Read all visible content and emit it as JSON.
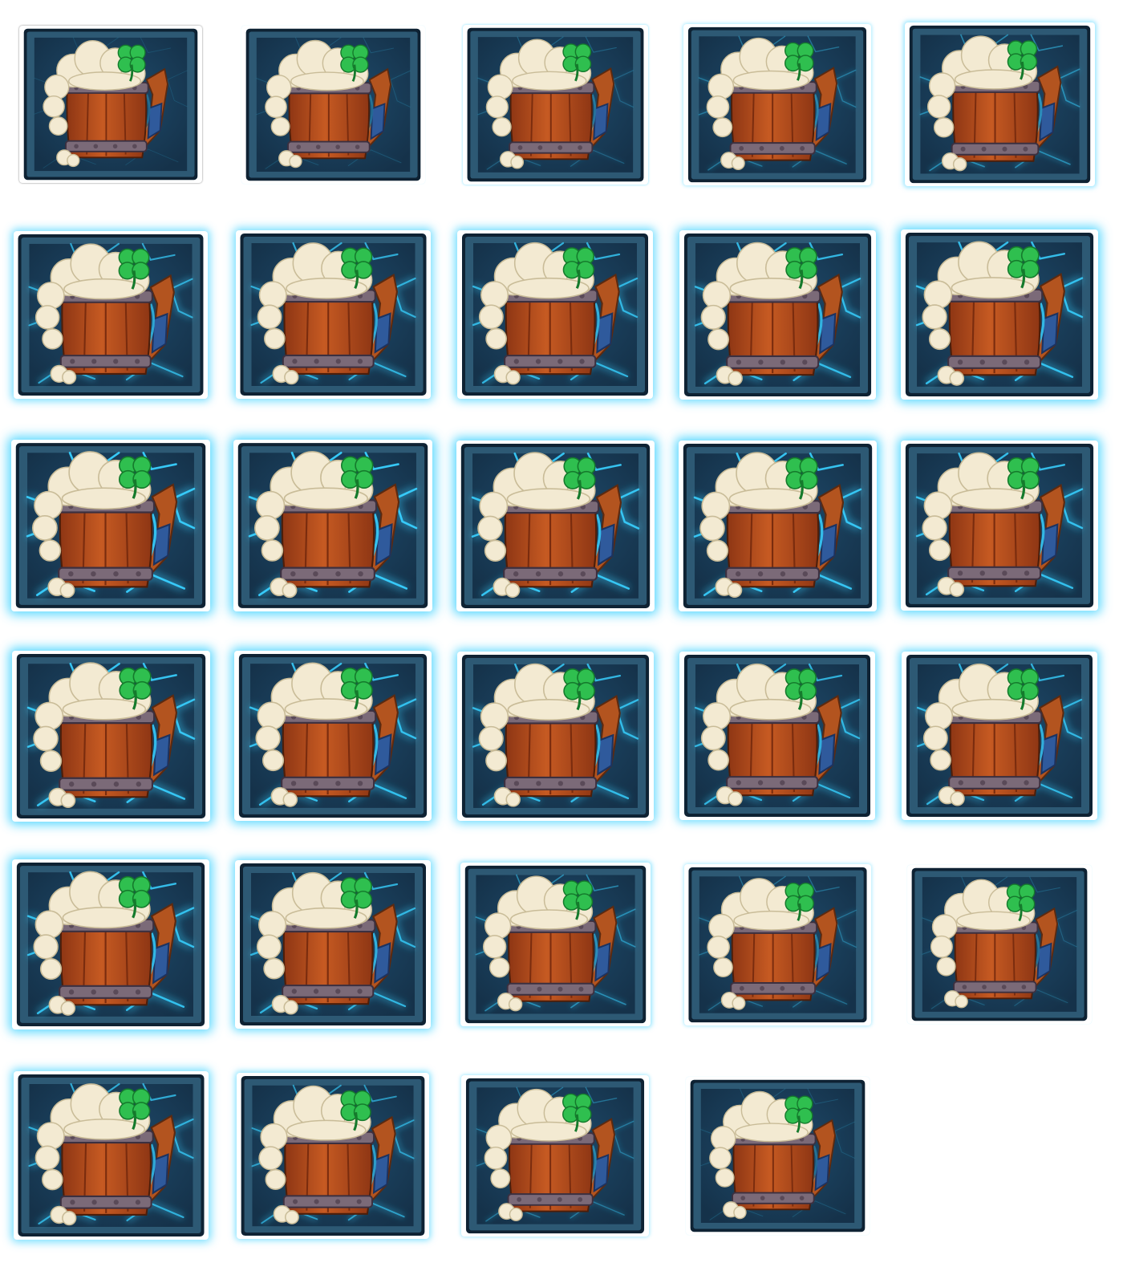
{
  "sheet": {
    "title": "",
    "symbol_name": "beer-mug-clover-symbol",
    "frame_count": 29,
    "columns": 5,
    "colors": {
      "background": "#ffffff",
      "tile_dark": "#15324a",
      "tile_mid": "#1f4d6e",
      "bevel": "#2d5974",
      "glow": "#38d0ff",
      "wood": "#c65a22",
      "wood_dark": "#8e3614",
      "metal": "#7b6a78",
      "foam": "#f3ead2",
      "clover": "#2fbf4f",
      "handle": "#b3541f",
      "grip": "#2f5a9c"
    }
  },
  "frames": [
    {
      "id": 1,
      "glow": 0.0
    },
    {
      "id": 2,
      "glow": 0.05
    },
    {
      "id": 3,
      "glow": 0.15
    },
    {
      "id": 4,
      "glow": 0.3
    },
    {
      "id": 5,
      "glow": 0.45
    },
    {
      "id": 6,
      "glow": 0.7
    },
    {
      "id": 7,
      "glow": 0.75
    },
    {
      "id": 8,
      "glow": 0.8
    },
    {
      "id": 9,
      "glow": 0.85
    },
    {
      "id": 10,
      "glow": 0.9
    },
    {
      "id": 11,
      "glow": 1.0
    },
    {
      "id": 12,
      "glow": 1.0
    },
    {
      "id": 13,
      "glow": 0.95
    },
    {
      "id": 14,
      "glow": 0.95
    },
    {
      "id": 15,
      "glow": 0.9
    },
    {
      "id": 16,
      "glow": 0.95
    },
    {
      "id": 17,
      "glow": 0.9
    },
    {
      "id": 18,
      "glow": 0.85
    },
    {
      "id": 19,
      "glow": 0.8
    },
    {
      "id": 20,
      "glow": 0.8
    },
    {
      "id": 21,
      "glow": 0.9
    },
    {
      "id": 22,
      "glow": 0.8
    },
    {
      "id": 23,
      "glow": 0.45
    },
    {
      "id": 24,
      "glow": 0.25
    },
    {
      "id": 25,
      "glow": 0.1
    },
    {
      "id": 26,
      "glow": 0.75
    },
    {
      "id": 27,
      "glow": 0.6
    },
    {
      "id": 28,
      "glow": 0.3
    },
    {
      "id": 29,
      "glow": 0.05
    }
  ]
}
